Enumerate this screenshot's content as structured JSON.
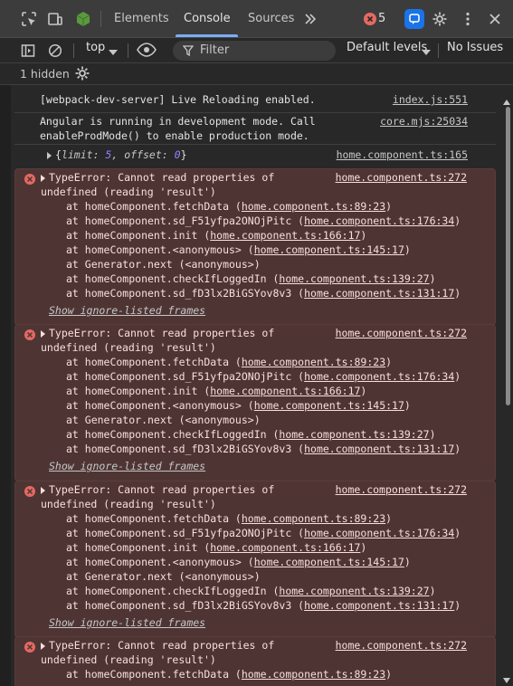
{
  "devtools": {
    "tabs": [
      "Elements",
      "Console",
      "Sources"
    ],
    "active_tab": "Console",
    "error_count": "5",
    "accent_color": "#7cacf8"
  },
  "toolbar": {
    "context": "top",
    "filter_placeholder": "Filter",
    "levels": "Default levels",
    "issues": "No Issues",
    "hidden": "1 hidden"
  },
  "console": {
    "log1": {
      "text": "[webpack-dev-server] Live Reloading enabled.",
      "source": "index.js:551"
    },
    "log2": {
      "line1": "Angular is running in development mode. Call",
      "line2": "enableProdMode() to enable production mode.",
      "source": "core.mjs:25034"
    },
    "log3": {
      "k1": "limit",
      "v1": "5",
      "k2": "offset",
      "v2": "0",
      "source": "home.component.ts:165"
    },
    "errors": [
      {
        "line1": "TypeError: Cannot read properties of",
        "line2": "undefined (reading 'result')",
        "source": "home.component.ts:272",
        "frames": [
          {
            "fn": "at homeComponent.fetchData (",
            "link": "home.component.ts:89:23",
            "end": ")"
          },
          {
            "fn": "at homeComponent.sd_F51yfpa2ONOjPitc (",
            "link": "home.component.ts:176:34",
            "end": ")"
          },
          {
            "fn": "at homeComponent.init (",
            "link": "home.component.ts:166:17",
            "end": ")"
          },
          {
            "fn": "at homeComponent.<anonymous> (",
            "link": "home.component.ts:145:17",
            "end": ")"
          },
          {
            "fn": "at Generator.next (<anonymous>)",
            "link": "",
            "end": ""
          },
          {
            "fn": "at homeComponent.checkIfLoggedIn (",
            "link": "home.component.ts:139:27",
            "end": ")"
          },
          {
            "fn": "at homeComponent.sd_fD3lx2BiGSYov8v3 (",
            "link": "home.component.ts:131:17",
            "end": ")"
          }
        ],
        "ignore": "Show ignore-listed frames"
      },
      {
        "line1": "TypeError: Cannot read properties of",
        "line2": "undefined (reading 'result')",
        "source": "home.component.ts:272",
        "frames": [
          {
            "fn": "at homeComponent.fetchData (",
            "link": "home.component.ts:89:23",
            "end": ")"
          },
          {
            "fn": "at homeComponent.sd_F51yfpa2ONOjPitc (",
            "link": "home.component.ts:176:34",
            "end": ")"
          },
          {
            "fn": "at homeComponent.init (",
            "link": "home.component.ts:166:17",
            "end": ")"
          },
          {
            "fn": "at homeComponent.<anonymous> (",
            "link": "home.component.ts:145:17",
            "end": ")"
          },
          {
            "fn": "at Generator.next (<anonymous>)",
            "link": "",
            "end": ""
          },
          {
            "fn": "at homeComponent.checkIfLoggedIn (",
            "link": "home.component.ts:139:27",
            "end": ")"
          },
          {
            "fn": "at homeComponent.sd_fD3lx2BiGSYov8v3 (",
            "link": "home.component.ts:131:17",
            "end": ")"
          }
        ],
        "ignore": "Show ignore-listed frames"
      },
      {
        "line1": "TypeError: Cannot read properties of",
        "line2": "undefined (reading 'result')",
        "source": "home.component.ts:272",
        "frames": [
          {
            "fn": "at homeComponent.fetchData (",
            "link": "home.component.ts:89:23",
            "end": ")"
          },
          {
            "fn": "at homeComponent.sd_F51yfpa2ONOjPitc (",
            "link": "home.component.ts:176:34",
            "end": ")"
          },
          {
            "fn": "at homeComponent.init (",
            "link": "home.component.ts:166:17",
            "end": ")"
          },
          {
            "fn": "at homeComponent.<anonymous> (",
            "link": "home.component.ts:145:17",
            "end": ")"
          },
          {
            "fn": "at Generator.next (<anonymous>)",
            "link": "",
            "end": ""
          },
          {
            "fn": "at homeComponent.checkIfLoggedIn (",
            "link": "home.component.ts:139:27",
            "end": ")"
          },
          {
            "fn": "at homeComponent.sd_fD3lx2BiGSYov8v3 (",
            "link": "home.component.ts:131:17",
            "end": ")"
          }
        ],
        "ignore": "Show ignore-listed frames"
      },
      {
        "line1": "TypeError: Cannot read properties of",
        "line2": "undefined (reading 'result')",
        "source": "home.component.ts:272",
        "frames": [
          {
            "fn": "at homeComponent.fetchData (",
            "link": "home.component.ts:89:23",
            "end": ")"
          }
        ],
        "ignore": ""
      }
    ]
  }
}
